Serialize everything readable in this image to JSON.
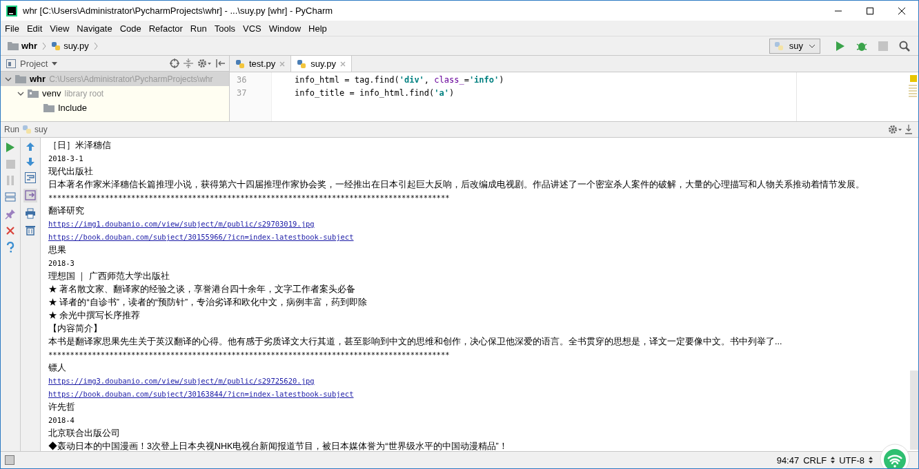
{
  "window": {
    "title": "whr [C:\\Users\\Administrator\\PycharmProjects\\whr] - ...\\suy.py [whr] - PyCharm"
  },
  "menu": [
    "File",
    "Edit",
    "View",
    "Navigate",
    "Code",
    "Refactor",
    "Run",
    "Tools",
    "VCS",
    "Window",
    "Help"
  ],
  "breadcrumbs": [
    {
      "kind": "folder",
      "label": "whr"
    },
    {
      "kind": "file",
      "label": "suy.py"
    }
  ],
  "run_config": {
    "label": "suy"
  },
  "project_panel": {
    "title": "Project",
    "tree": [
      {
        "label": "whr",
        "hint": "C:\\Users\\Administrator\\PycharmProjects\\whr",
        "expanded": true,
        "selected": true,
        "children": [
          {
            "label": "venv",
            "hint": "library root",
            "expanded": true,
            "selected": false,
            "children": [
              {
                "label": "Include",
                "selected": false
              }
            ]
          }
        ]
      }
    ]
  },
  "editor": {
    "tabs": [
      {
        "label": "test.py",
        "selected": false
      },
      {
        "label": "suy.py",
        "selected": true
      }
    ],
    "lines": [
      {
        "number": "36",
        "tokens": [
          {
            "kind": "plain",
            "text": "info_html = tag.find("
          },
          {
            "kind": "string",
            "text": "'div'"
          },
          {
            "kind": "plain",
            "text": ", "
          },
          {
            "kind": "param",
            "text": "class_"
          },
          {
            "kind": "plain",
            "text": "="
          },
          {
            "kind": "string",
            "text": "'info'"
          },
          {
            "kind": "plain",
            "text": ")"
          }
        ]
      },
      {
        "number": "37",
        "tokens": [
          {
            "kind": "plain",
            "text": "info_title = info_html.find("
          },
          {
            "kind": "string",
            "text": "'a'"
          },
          {
            "kind": "plain",
            "text": ")"
          }
        ]
      }
    ]
  },
  "run_panel": {
    "title": "Run",
    "config": "suy",
    "output": [
      {
        "kind": "text",
        "text": "［日］米泽穗信"
      },
      {
        "kind": "mono",
        "text": "2018-3-1"
      },
      {
        "kind": "text",
        "text": "现代出版社"
      },
      {
        "kind": "text",
        "text": "日本著名作家米泽穗信长篇推理小说，获得第六十四届推理作家协会奖，一经推出在日本引起巨大反响，后改编成电视剧。作品讲述了一个密室杀人案件的破解，大量的心理描写和人物关系推动着情节发展。"
      },
      {
        "kind": "mono",
        "text": "********************************************************************************************"
      },
      {
        "kind": "text",
        "text": "翻译研究"
      },
      {
        "kind": "link",
        "text": "https://img1.doubanio.com/view/subject/m/public/s29703019.jpg"
      },
      {
        "kind": "link",
        "text": "https://book.douban.com/subject/30155966/?icn=index-latestbook-subject"
      },
      {
        "kind": "text",
        "text": "思果"
      },
      {
        "kind": "mono",
        "text": "2018-3"
      },
      {
        "kind": "text",
        "text": "理想国 ｜ 广西师范大学出版社"
      },
      {
        "kind": "text",
        "text": "★ 著名散文家、翻译家的经验之谈，享誉港台四十余年，文字工作者案头必备"
      },
      {
        "kind": "text",
        "text": "★ 译者的“自诊书”，读者的“预防针”，专治劣译和欧化中文，病例丰富，药到即除"
      },
      {
        "kind": "text",
        "text": "★ 余光中撰写长序推荐"
      },
      {
        "kind": "text",
        "text": "【内容简介】"
      },
      {
        "kind": "text",
        "text": "本书是翻译家思果先生关于英汉翻译的心得。他有感于劣质译文大行其道，甚至影响到中文的思维和创作，决心保卫他深爱的语言。全书贯穿的思想是，译文一定要像中文。书中列举了..."
      },
      {
        "kind": "mono",
        "text": "********************************************************************************************"
      },
      {
        "kind": "text",
        "text": "镖人"
      },
      {
        "kind": "link",
        "text": "https://img3.doubanio.com/view/subject/m/public/s29725620.jpg"
      },
      {
        "kind": "link",
        "text": "https://book.douban.com/subject/30163844/?icn=index-latestbook-subject"
      },
      {
        "kind": "text",
        "text": "许先哲"
      },
      {
        "kind": "mono",
        "text": "2018-4"
      },
      {
        "kind": "text",
        "text": "北京联合出版公司"
      },
      {
        "kind": "text",
        "text": "◆轰动日本的中国漫画！3次登上日本央视NHK电视台新闻报道节目，被日本媒体誉为“世界级水平的中国动漫精品”！"
      }
    ]
  },
  "status_bar": {
    "position": "94:47",
    "line_ending": "CRLF",
    "encoding": "UTF-8"
  }
}
